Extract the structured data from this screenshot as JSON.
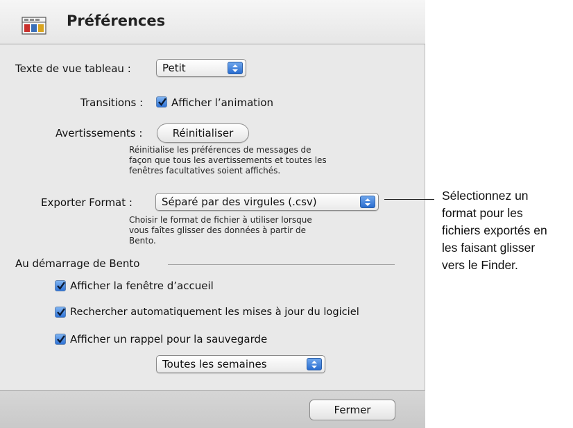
{
  "window": {
    "title": "Préférences",
    "icon": "preferences-icon"
  },
  "table_view": {
    "label": "Texte de vue tableau :",
    "value": "Petit"
  },
  "transitions": {
    "label": "Transitions :",
    "checkbox_label": "Afficher l’animation",
    "checked": true
  },
  "warnings": {
    "label": "Avertissements :",
    "button_label": "Réinitialiser",
    "help_lines": [
      "Réinitialise les préférences de messages de",
      "façon que tous les avertissements et toutes les",
      "fenêtres facultatives soient affichés."
    ]
  },
  "export": {
    "label": "Exporter Format :",
    "value": "Séparé par des virgules (.csv)",
    "help_lines": [
      "Choisir le format de fichier à utiliser lorsque",
      "vous faîtes glisser des données à partir de",
      "Bento."
    ]
  },
  "startup": {
    "group_title": "Au démarrage de Bento",
    "show_welcome": {
      "label": "Afficher la fenêtre d’accueil",
      "checked": true
    },
    "check_updates": {
      "label": "Rechercher automatiquement les mises à jour du logiciel",
      "checked": true
    },
    "backup_reminder": {
      "label": "Afficher un rappel pour la sauvegarde",
      "checked": true
    },
    "backup_frequency": "Toutes les semaines"
  },
  "footer": {
    "close_label": "Fermer"
  },
  "callout": {
    "lines": [
      "Sélectionnez un",
      "format pour les",
      "fichiers exportés en",
      "les faisant glisser",
      "vers le Finder."
    ]
  },
  "colors": {
    "accent": "#2f73d6",
    "window_bg": "#e9e9e9",
    "footer_bg": "#cfcfcf"
  }
}
